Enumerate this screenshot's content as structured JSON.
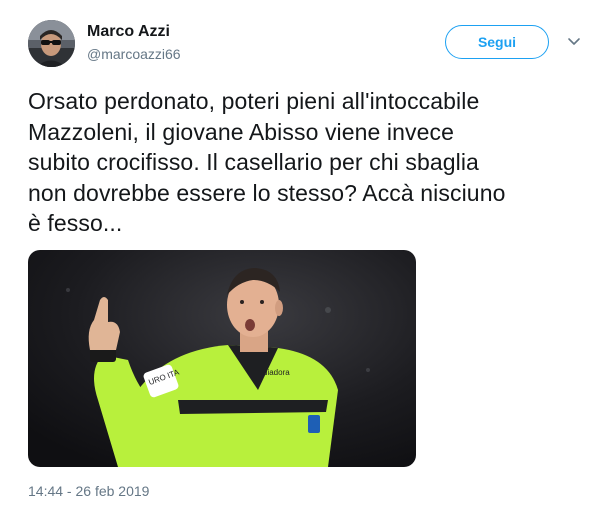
{
  "tweet": {
    "display_name": "Marco Azzi",
    "handle": "@marcoazzi66",
    "follow_label": "Segui",
    "text_lines": [
      "Orsato perdonato, poteri pieni all'intoccabile",
      "Mazzoleni, il giovane Abisso viene invece",
      "subito crocifisso. Il casellario per chi sbaglia",
      "non dovrebbe essere lo stesso? Accà nisciuno",
      "è fesso..."
    ],
    "timestamp": "14:44 - 26 feb 2019"
  },
  "media": {
    "jersey_text": "URO ITA"
  },
  "colors": {
    "accent": "#1da1f2",
    "text_primary": "#14171a",
    "text_secondary": "#657786",
    "referee_shirt": "#b8f03c"
  },
  "icons": {
    "menu": "chevron-down-icon"
  }
}
